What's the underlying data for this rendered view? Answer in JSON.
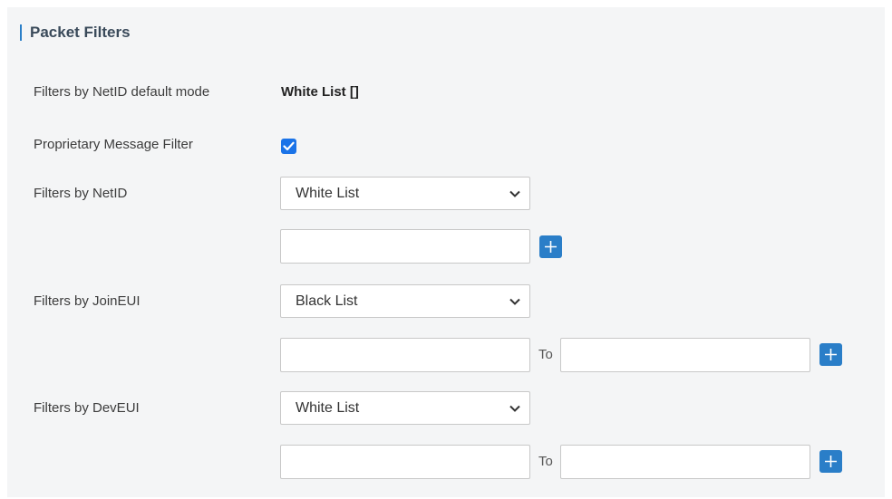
{
  "section": {
    "title": "Packet Filters"
  },
  "fields": {
    "netid_default_mode": {
      "label": "Filters by NetID default mode",
      "value": "White List []"
    },
    "proprietary_filter": {
      "label": "Proprietary Message Filter",
      "checked": true
    },
    "netid": {
      "label": "Filters by NetID",
      "selected": "White List",
      "add_icon": "plus-icon"
    },
    "joineui": {
      "label": "Filters by JoinEUI",
      "selected": "Black List",
      "to_label": "To",
      "add_icon": "plus-icon"
    },
    "deveui": {
      "label": "Filters by DevEUI",
      "selected": "White List",
      "to_label": "To",
      "add_icon": "plus-icon"
    }
  },
  "colors": {
    "accent": "#2a7ec8",
    "checkbox": "#1a73e8",
    "panel_bg": "#f4f5f6"
  }
}
